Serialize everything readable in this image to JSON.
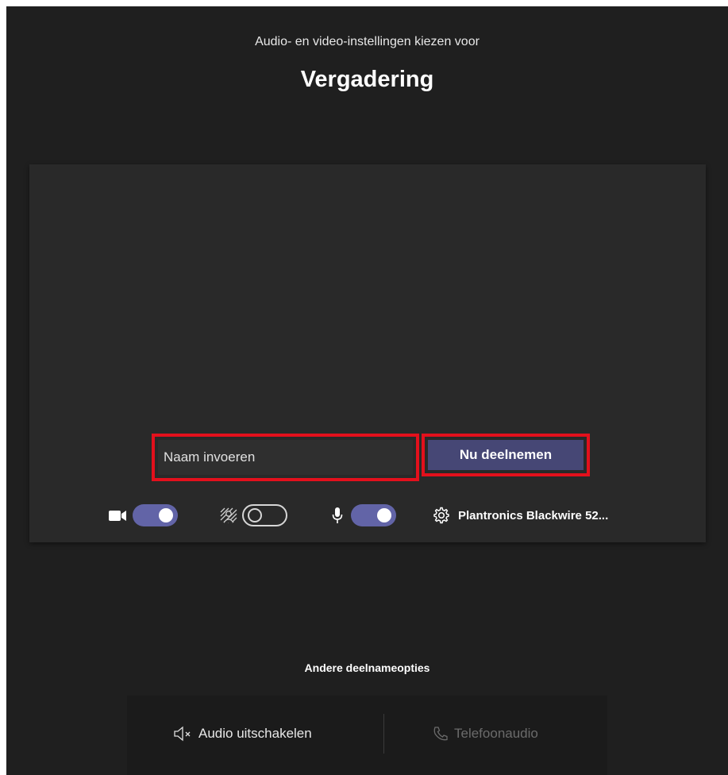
{
  "header": {
    "subtitle": "Audio- en video-instellingen kiezen voor",
    "title": "Vergadering"
  },
  "preview": {
    "name_placeholder": "Naam invoeren",
    "join_label": "Nu deelnemen",
    "controls": {
      "camera": {
        "icon": "camera-icon",
        "state": "on"
      },
      "background_effects": {
        "icon": "background-blur-icon",
        "state": "off"
      },
      "microphone": {
        "icon": "microphone-icon",
        "state": "on"
      },
      "device": {
        "icon": "gear-icon",
        "label": "Plantronics Blackwire 52..."
      }
    }
  },
  "other_options": {
    "title": "Andere deelnameopties",
    "audio_off_label": "Audio uitschakelen",
    "phone_audio_label": "Telefoonaudio"
  },
  "colors": {
    "background": "#1f1f1f",
    "panel": "#292929",
    "accent": "#6264a7",
    "join_button": "#464775",
    "highlight": "#e3101c"
  }
}
